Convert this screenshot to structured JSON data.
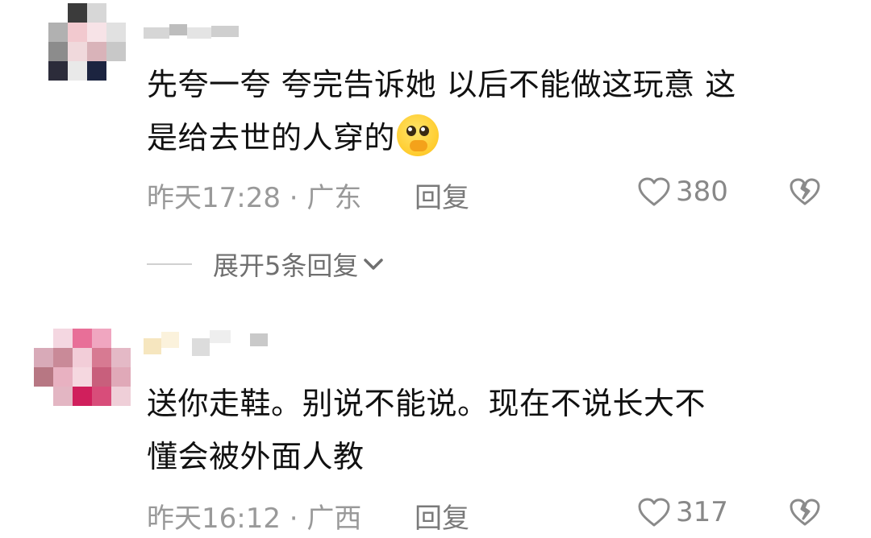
{
  "comments": [
    {
      "text_line1": "先夸一夸 夸完告诉她 以后不能做这玩意 这",
      "text_line2": "是给去世的人穿的",
      "emoji": "pleading-hands-over-mouth-emoji",
      "time_location": "昨天17:28 · 广东",
      "reply_label": "回复",
      "likes": "380",
      "expand_label": "展开5条回复"
    },
    {
      "text_line1": "送你走鞋。别说不能说。现在不说长大不",
      "text_line2": "懂会被外面人教",
      "time_location": "昨天16:12 · 广西",
      "reply_label": "回复",
      "likes": "317"
    }
  ],
  "icons": {
    "like": "heart-outline-icon",
    "dislike": "broken-heart-icon",
    "expand": "chevron-down-icon"
  },
  "colors": {
    "text": "#111111",
    "meta": "#999999",
    "accent_emoji": "#ffcc2e"
  }
}
